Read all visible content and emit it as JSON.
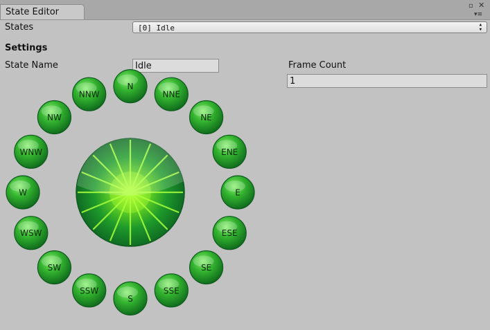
{
  "window": {
    "tab_title": "State Editor",
    "maximize_glyph": "▫",
    "close_glyph": "✕",
    "menu_glyph": "▾≡"
  },
  "states": {
    "label": "States",
    "selected": "[0] Idle",
    "arrows": "▴▾"
  },
  "settings": {
    "heading": "Settings",
    "state_name_label": "State Name",
    "state_name_value": "Idle",
    "frame_count_label": "Frame Count",
    "frame_count_value": "1"
  },
  "direction_buttons": [
    "N",
    "NNE",
    "NE",
    "ENE",
    "E",
    "ESE",
    "SE",
    "SSE",
    "S",
    "SSW",
    "SW",
    "WSW",
    "W",
    "WNW",
    "NW",
    "NNW"
  ],
  "colors": {
    "button_light": "#7ee86a",
    "button_mid": "#2aa22a",
    "button_dark": "#126f1e",
    "center_glow": "#b8ff3a",
    "ray": "#a6ff3c"
  },
  "icons": {
    "center": "compass-rose-icon"
  }
}
